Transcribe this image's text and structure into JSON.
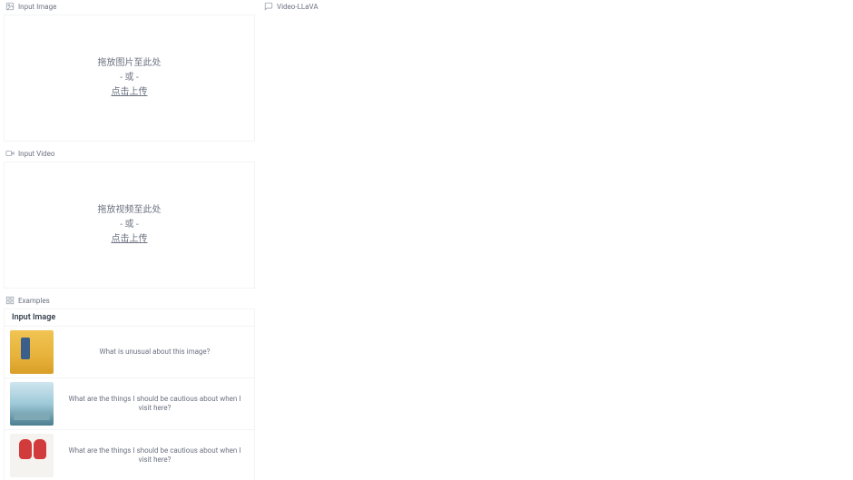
{
  "left": {
    "image_panel": {
      "label": "Input Image",
      "drop_main": "拖放图片至此处",
      "drop_or": "- 或 -",
      "drop_click": "点击上传"
    },
    "video_panel": {
      "label": "Input Video",
      "drop_main": "拖放视频至此处",
      "drop_or": "- 或 -",
      "drop_click": "点击上传"
    },
    "examples": {
      "label": "Examples",
      "column_header": "Input Image",
      "rows": [
        {
          "thumb_class": "taxi",
          "prompt": "What is unusual about this image?"
        },
        {
          "thumb_class": "lake",
          "prompt": "What are the things I should be cautious about when I visit here?"
        },
        {
          "thumb_class": "gloves",
          "prompt": "What are the things I should be cautious about when I visit here?"
        }
      ]
    }
  },
  "right": {
    "title": "Video-LLaVA"
  }
}
